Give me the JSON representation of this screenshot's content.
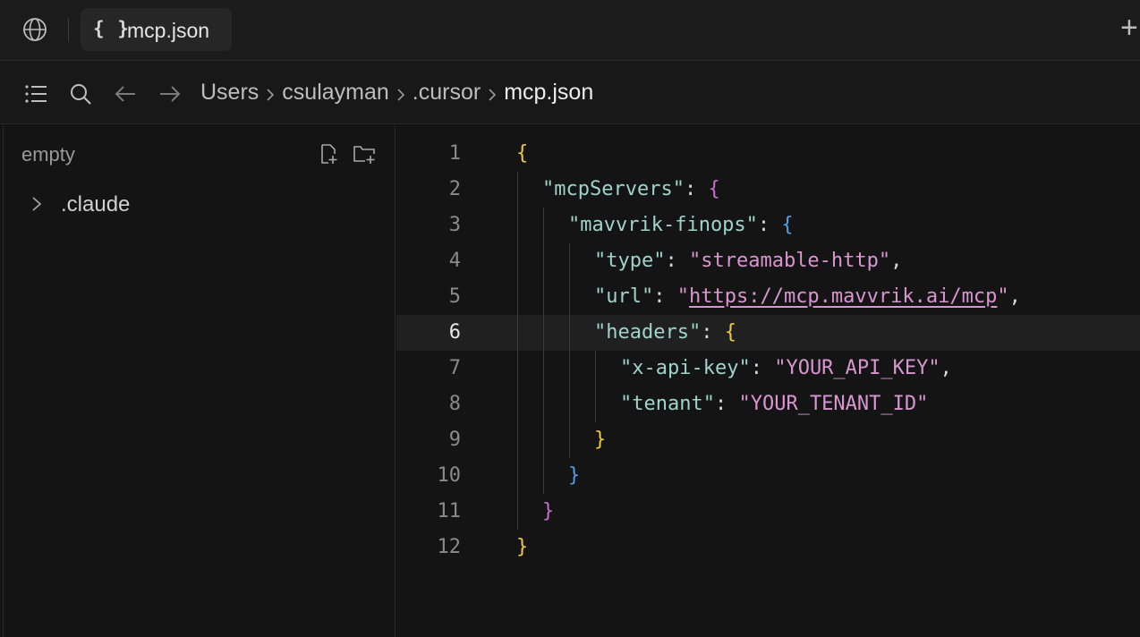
{
  "tab": {
    "icon": "braces-icon",
    "glyph": "{ }",
    "label": "mcp.json"
  },
  "breadcrumb": {
    "items": [
      "Users",
      "csulayman",
      ".cursor",
      "mcp.json"
    ]
  },
  "sidebar": {
    "title": "empty",
    "items": [
      {
        "label": ".claude",
        "icon": "chevron-right-icon"
      }
    ]
  },
  "editor": {
    "active_line": 6,
    "lines": [
      {
        "n": "1",
        "parts": [
          {
            "t": "{",
            "c": "b1"
          }
        ]
      },
      {
        "n": "2",
        "parts": [
          {
            "t": "\"mcpServers\"",
            "c": "k"
          },
          {
            "t": ": ",
            "c": "p"
          },
          {
            "t": "{",
            "c": "b2"
          }
        ]
      },
      {
        "n": "3",
        "parts": [
          {
            "t": "\"mavvrik-finops\"",
            "c": "k"
          },
          {
            "t": ": ",
            "c": "p"
          },
          {
            "t": "{",
            "c": "b3"
          }
        ]
      },
      {
        "n": "4",
        "parts": [
          {
            "t": "\"type\"",
            "c": "k"
          },
          {
            "t": ": ",
            "c": "p"
          },
          {
            "t": "\"streamable-http\"",
            "c": "s"
          },
          {
            "t": ",",
            "c": "p"
          }
        ]
      },
      {
        "n": "5",
        "parts": [
          {
            "t": "\"url\"",
            "c": "k"
          },
          {
            "t": ": ",
            "c": "p"
          },
          {
            "t": "\"",
            "c": "s"
          },
          {
            "t": "https://mcp.mavvrik.ai/mcp",
            "c": "s u"
          },
          {
            "t": "\"",
            "c": "s"
          },
          {
            "t": ",",
            "c": "p"
          }
        ]
      },
      {
        "n": "6",
        "parts": [
          {
            "t": "\"headers\"",
            "c": "k"
          },
          {
            "t": ": ",
            "c": "p"
          },
          {
            "t": "{",
            "c": "b1"
          }
        ]
      },
      {
        "n": "7",
        "parts": [
          {
            "t": "\"x-api-key\"",
            "c": "k"
          },
          {
            "t": ": ",
            "c": "p"
          },
          {
            "t": "\"YOUR_API_KEY\"",
            "c": "s"
          },
          {
            "t": ",",
            "c": "p"
          }
        ]
      },
      {
        "n": "8",
        "parts": [
          {
            "t": "\"tenant\"",
            "c": "k"
          },
          {
            "t": ": ",
            "c": "p"
          },
          {
            "t": "\"YOUR_TENANT_ID\"",
            "c": "s"
          }
        ]
      },
      {
        "n": "9",
        "parts": [
          {
            "t": "}",
            "c": "b1"
          }
        ]
      },
      {
        "n": "10",
        "parts": [
          {
            "t": "}",
            "c": "b3"
          }
        ]
      },
      {
        "n": "11",
        "parts": [
          {
            "t": "}",
            "c": "b2"
          }
        ]
      },
      {
        "n": "12",
        "parts": [
          {
            "t": "}",
            "c": "b1"
          }
        ]
      }
    ]
  },
  "colors": {
    "key": "#9fd3cc",
    "string": "#d995d0",
    "bracket_1": "#f0c840",
    "bracket_2": "#c670d0",
    "bracket_3": "#4f9ee8"
  }
}
